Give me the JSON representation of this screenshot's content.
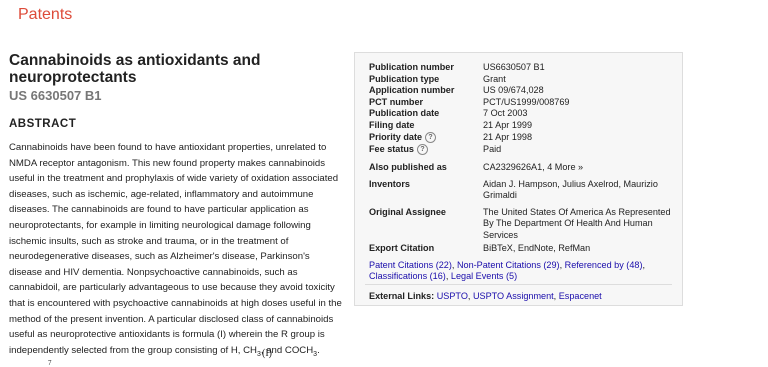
{
  "header": {
    "brand": "Patents"
  },
  "patent": {
    "title": "Cannabinoids as antioxidants and neuroprotectants",
    "number": "US 6630507 B1"
  },
  "abstract": {
    "heading": "ABSTRACT",
    "text": "Cannabinoids have been found to have antioxidant properties, unrelated to NMDA receptor antagonism. This new found property makes cannabinoids useful in the treatment and prophylaxis of wide variety of oxidation associated diseases, such as ischemic, age-related, inflammatory and autoimmune diseases. The cannabinoids are found to have particular application as neuroprotectants, for example in limiting neurological damage following ischemic insults, such as stroke and trauma, or in the treatment of neurodegenerative diseases, such as Alzheimer's disease, Parkinson's disease and HIV dementia. Nonpsychoactive cannabinoids, such as cannabidoil, are particularly advantageous to use because they avoid toxicity that is encountered with psychoactive cannabinoids at high doses useful in the method of the present invention. A particular disclosed class of cannabinoids useful as neuroprotective antioxidants is formula (I) wherein the R group is independently selected from the group consisting of H, CH",
    "sub1": "3",
    "mid": ", and COCH",
    "sub2": "3",
    "end": ".",
    "formula_label": "(I)",
    "formula_num": "7"
  },
  "meta": {
    "publication_number": {
      "label": "Publication number",
      "value": "US6630507 B1"
    },
    "publication_type": {
      "label": "Publication type",
      "value": "Grant"
    },
    "application_number": {
      "label": "Application number",
      "value": "US 09/674,028"
    },
    "pct_number": {
      "label": "PCT number",
      "value": "PCT/US1999/008769"
    },
    "publication_date": {
      "label": "Publication date",
      "value": "7 Oct 2003"
    },
    "filing_date": {
      "label": "Filing date",
      "value": "21 Apr 1999"
    },
    "priority_date": {
      "label": "Priority date",
      "value": "21 Apr 1998"
    },
    "fee_status": {
      "label": "Fee status",
      "value": "Paid"
    },
    "also_published": {
      "label": "Also published as",
      "value": "CA2329626A1, 4 More »"
    },
    "inventors": {
      "label": "Inventors",
      "value": "Aidan J. Hampson, Julius Axelrod, Maurizio Grimaldi"
    },
    "assignee": {
      "label": "Original Assignee",
      "value": "The United States Of America As Represented By The Department Of Health And Human Services"
    },
    "export": {
      "label": "Export Citation",
      "value": "BiBTeX, EndNote, RefMan"
    },
    "help_glyph": "?"
  },
  "citations": {
    "patent": "Patent Citations (22)",
    "non_patent": "Non-Patent Citations (29)",
    "referenced": "Referenced by (48)",
    "classifications": "Classifications (16)",
    "legal": "Legal Events (5)",
    "sep": ", "
  },
  "external": {
    "label": "External Links:",
    "uspto": "USPTO",
    "assignment": "USPTO Assignment",
    "espacenet": "Espacenet",
    "sep": ", "
  }
}
